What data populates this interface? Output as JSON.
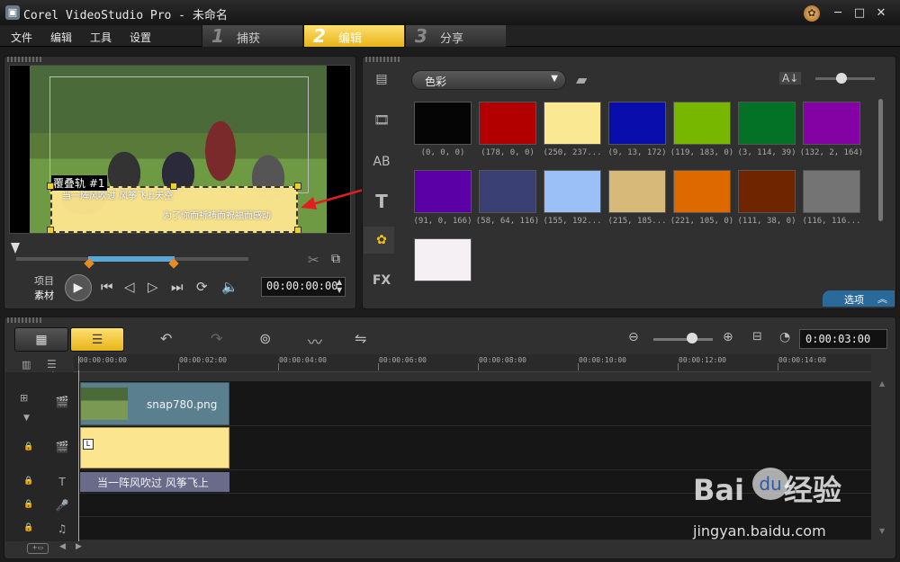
{
  "window": {
    "title": "Corel VideoStudio Pro - 未命名",
    "controls": {
      "minimize": "─",
      "maximize": "□",
      "close": "✕"
    }
  },
  "menu": {
    "items": [
      "文件",
      "编辑",
      "工具",
      "设置"
    ]
  },
  "steps": [
    {
      "num": "1",
      "label": "捕获",
      "active": false
    },
    {
      "num": "2",
      "label": "编辑",
      "active": true
    },
    {
      "num": "3",
      "label": "分享",
      "active": false
    }
  ],
  "preview": {
    "overlay_track_label": "覆叠轨 #1",
    "overlay_text_line1": "当一阵风吹过  风筝飞上天空",
    "overlay_text_line2": "为了你而祈祷而祝福而感动",
    "mode_project": "项目",
    "mode_clip": "素材",
    "timecode": "00:00:00:00"
  },
  "library": {
    "dropdown_value": "色彩",
    "swatches": [
      {
        "color": "#050505",
        "caption": "(0, 0, 0)"
      },
      {
        "color": "#b20000",
        "caption": "(178, 0, 0)"
      },
      {
        "color": "#fae892",
        "caption": "(250, 237..."
      },
      {
        "color": "#090dac",
        "caption": "(9, 13, 172)"
      },
      {
        "color": "#77b700",
        "caption": "(119, 183, 0)"
      },
      {
        "color": "#037227",
        "caption": "(3, 114, 39)"
      },
      {
        "color": "#8402a4",
        "caption": "(132, 2, 164)"
      },
      {
        "color": "#5b00a6",
        "caption": "(91, 0, 166)"
      },
      {
        "color": "#3a4074",
        "caption": "(58, 64, 116)"
      },
      {
        "color": "#9bc0f8",
        "caption": "(155, 192..."
      },
      {
        "color": "#d7b97a",
        "caption": "(215, 185..."
      },
      {
        "color": "#dd6900",
        "caption": "(221, 105, 0)"
      },
      {
        "color": "#6f2600",
        "caption": "(111, 38, 0)"
      },
      {
        "color": "#747474",
        "caption": "(116, 116..."
      },
      {
        "color": "#f4f0f4",
        "caption": ""
      }
    ],
    "options_label": "选项"
  },
  "timeline": {
    "timecode": "0:00:03:00",
    "ruler": [
      "00:00:00:00",
      "00:00:02:00",
      "00:00:04:00",
      "00:00:06:00",
      "00:00:08:00",
      "00:00:10:00",
      "00:00:12:00",
      "00:00:14:00"
    ],
    "video_clip_name": "snap780.png",
    "title_clip_text": "当一阵风吹过  风筝飞上"
  },
  "watermark": {
    "logo": "Bai",
    "logo2": "经验",
    "url": "jingyan.baidu.com"
  },
  "colors": {
    "accent": "#f0c020",
    "selection_blue": "#5aa8d8",
    "overlay_clip": "#fbe58e",
    "arrow": "#e02020"
  }
}
